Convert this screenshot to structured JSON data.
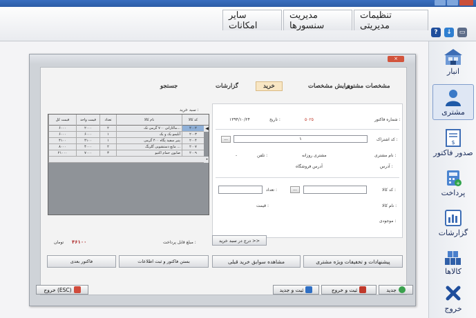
{
  "top_tabs": {
    "admin_settings": "تنظیمات مدیریتی",
    "sensor_management": "مدیریت سنسورها",
    "other_features": "سایر امکانات"
  },
  "sidebar": {
    "items": [
      {
        "label": "انبار",
        "icon": "warehouse-icon"
      },
      {
        "label": "مشتری",
        "icon": "customer-icon"
      },
      {
        "label": "صدور فاکتور",
        "icon": "invoice-icon"
      },
      {
        "label": "پرداخت",
        "icon": "payment-icon"
      },
      {
        "label": "گزارشات",
        "icon": "reports-icon"
      },
      {
        "label": "کالاها",
        "icon": "goods-icon"
      },
      {
        "label": "خروج",
        "icon": "exit-icon"
      }
    ],
    "active": "مشتری"
  },
  "dialog": {
    "tabs": {
      "customer_details": "مشخصات مشتری",
      "edit_details": "ویرایش مشخصات",
      "purchase": "خرید",
      "reports": "گزارشات",
      "search": "جستجو"
    },
    "form": {
      "invoice_no_label": "شماره فاکتور :",
      "invoice_no_value": "۵۰۲۵",
      "date_label": "تاریخ :",
      "date_value": "۱۳۹۴/۱۰/۲۴",
      "subscription_label": "کد اشتراک :",
      "subscription_value": "۱",
      "customer_name_label": "نام مشتری :",
      "customer_name_value": "مشتری روزانه",
      "phone_label": "تلفن :",
      "phone_value": "-",
      "address_label": "آدرس :",
      "address_value": "آدرس فروشگاه",
      "product_code_label": "کد کالا :",
      "product_code_value": "",
      "quantity_label": "تعداد :",
      "product_name_label": "نام کالا :",
      "price_label": "قیمت :",
      "stock_label": "موجودی :",
      "browse": "..."
    },
    "cart": {
      "label": "سبد خرید :",
      "headers": {
        "code": "کد کالا",
        "name": "نام کالا",
        "qty": "تعداد",
        "unit_price": "قیمت واحد",
        "total": "قیمت کل"
      },
      "rows": [
        {
          "code": "۲۰۰۲",
          "name": "ماکارانی ۷۰۰ گرمی تک...",
          "qty": "۲",
          "unit_price": "۲۰۰۰",
          "total": "۶۰۰۰"
        },
        {
          "code": "۲۰۰۳",
          "name": "آبلیمو یک و یک",
          "qty": "۱",
          "unit_price": "۶۰۰۰",
          "total": "۶۰۰۰"
        },
        {
          "code": "۲۰۰۴",
          "name": "پنیر سفید پگاه ۴۰۰ گرمی",
          "qty": "۱",
          "unit_price": "۴۱۰۰",
          "total": "۴۱۰۰"
        },
        {
          "code": "۲۰۰۷",
          "name": "مایع دستشویی گلرنگ ...",
          "qty": "۲",
          "unit_price": "۴۰۰۰",
          "total": "۸۰۰۰"
        },
        {
          "code": "۲۰۰۹",
          "name": "صابون حمام اکتیو",
          "qty": "۳",
          "unit_price": "۷۰۰۰",
          "total": "۲۱۰۰۰"
        }
      ]
    },
    "payable_label": "مبلغ قابل پرداخت :",
    "payable_value": "۴۶۱۰۰",
    "currency": "تومان",
    "add_to_cart": "درج در سبد خرید >>",
    "buttons": {
      "suggestions": "پیشنهادات و تخفیفات ویژه مشتری",
      "history": "مشاهده سوابق خرید قبلی",
      "close_register": "بستن فاکتور و ثبت اطلاعات",
      "next_invoice": "فاکتور بعدی"
    },
    "footer": {
      "new": "جدید",
      "save_exit": "ثبت و خروج",
      "save_new": "ثبت و جدید",
      "exit": "خروج (ESC)"
    }
  }
}
